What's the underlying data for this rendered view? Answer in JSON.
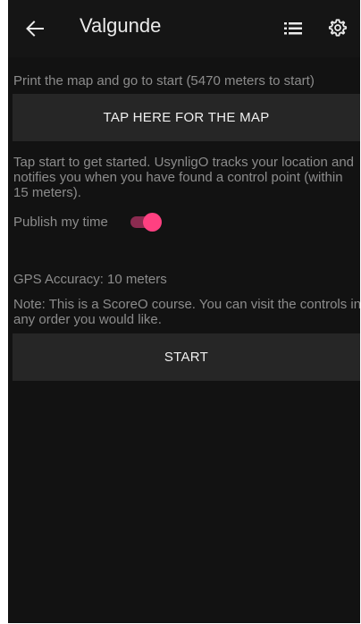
{
  "app_bar": {
    "title": "Valgunde",
    "back_icon": "arrow-left",
    "list_icon": "list",
    "settings_icon": "gear"
  },
  "main": {
    "print_instruction": "Print the map and go to start (5470 meters to start)",
    "map_button_label": "TAP HERE FOR THE MAP",
    "tracking_info": "Tap start to get started. UsynligO tracks your location and notifies you when you have found a control point (within 15 meters).",
    "publish_label": "Publish my time",
    "publish_enabled": true,
    "gps_accuracy": "GPS Accuracy: 10 meters",
    "course_note": "Note: This is a ScoreO course. You can visit the controls in any order you would like.",
    "start_button_label": "START"
  },
  "colors": {
    "background": "#121212",
    "accent": "#ff4081",
    "button_bg": "#262626"
  }
}
